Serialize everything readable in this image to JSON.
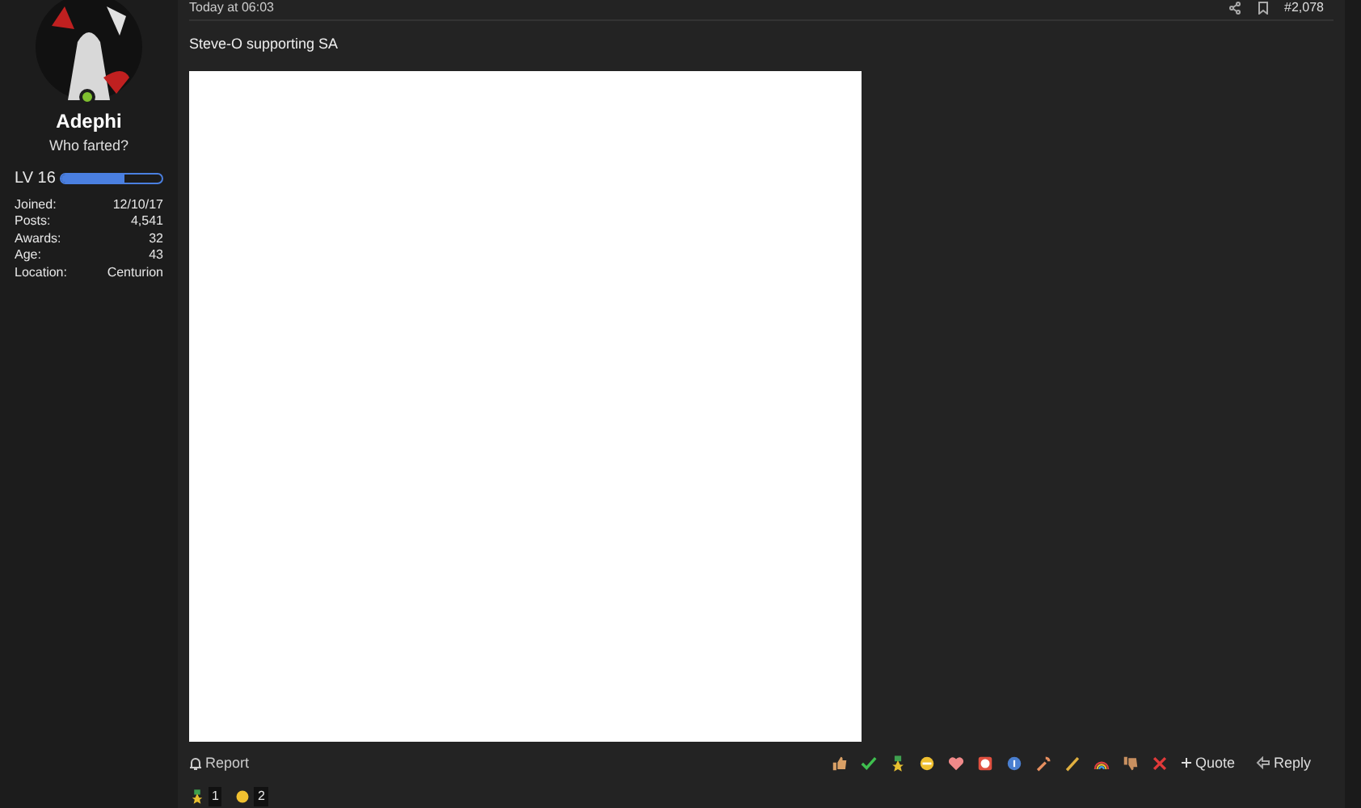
{
  "user": {
    "name": "Adephi",
    "title": "Who farted?",
    "online": true,
    "level_label": "LV 16",
    "level": 0.63,
    "stats": [
      {
        "label": "Joined:",
        "value": "12/10/17"
      },
      {
        "label": "Posts:",
        "value": "4,541"
      },
      {
        "label": "Awards:",
        "value": "32"
      },
      {
        "label": "Age:",
        "value": "43"
      },
      {
        "label": "Location:",
        "value": "Centurion"
      }
    ]
  },
  "post": {
    "time": "Today at 06:03",
    "number": "#2,078",
    "text": "Steve-O supporting SA"
  },
  "actions": {
    "report": "Report",
    "quote": "Quote",
    "reply": "Reply"
  },
  "ratings": [
    {
      "count": "1"
    },
    {
      "count": "2"
    }
  ]
}
